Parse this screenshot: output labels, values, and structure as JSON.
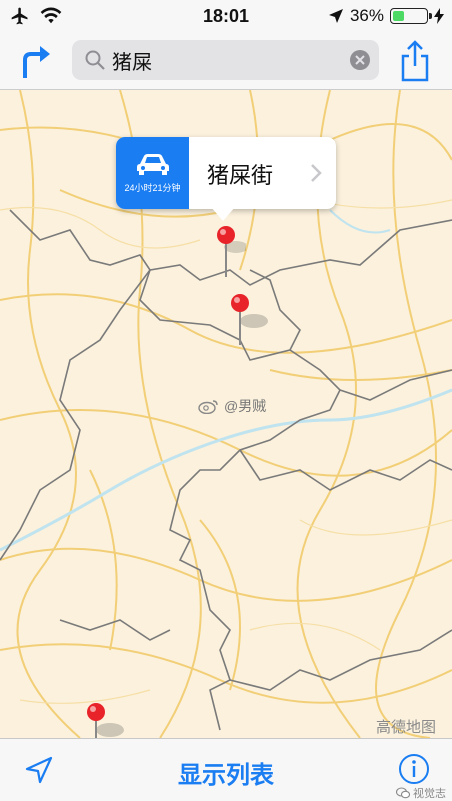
{
  "status_bar": {
    "time": "18:01",
    "battery_percent": "36%",
    "battery_level": 0.36,
    "icons": [
      "airplane-icon",
      "wifi-icon",
      "location-arrow-icon",
      "charging-bolt-icon"
    ]
  },
  "nav": {
    "search_query": "猪屎",
    "icons": [
      "directions-icon",
      "search-icon",
      "clear-icon",
      "share-icon"
    ]
  },
  "callout": {
    "title": "猪屎街",
    "eta": "24小时21分钟",
    "icon": "car-icon"
  },
  "map": {
    "watermark": "@男贼",
    "attribution": "高德地图",
    "pin_color": "#e8242a"
  },
  "toolbar": {
    "show_list_label": "显示列表",
    "icons": [
      "location-icon",
      "info-icon"
    ]
  },
  "overlay": {
    "wechat_watermark": "视觉志"
  },
  "colors": {
    "accent": "#1a7df2",
    "map_bg": "#fbf1dd",
    "road": "#f2cf77",
    "border": "#7a7a7a",
    "river": "#bfe3ef"
  }
}
